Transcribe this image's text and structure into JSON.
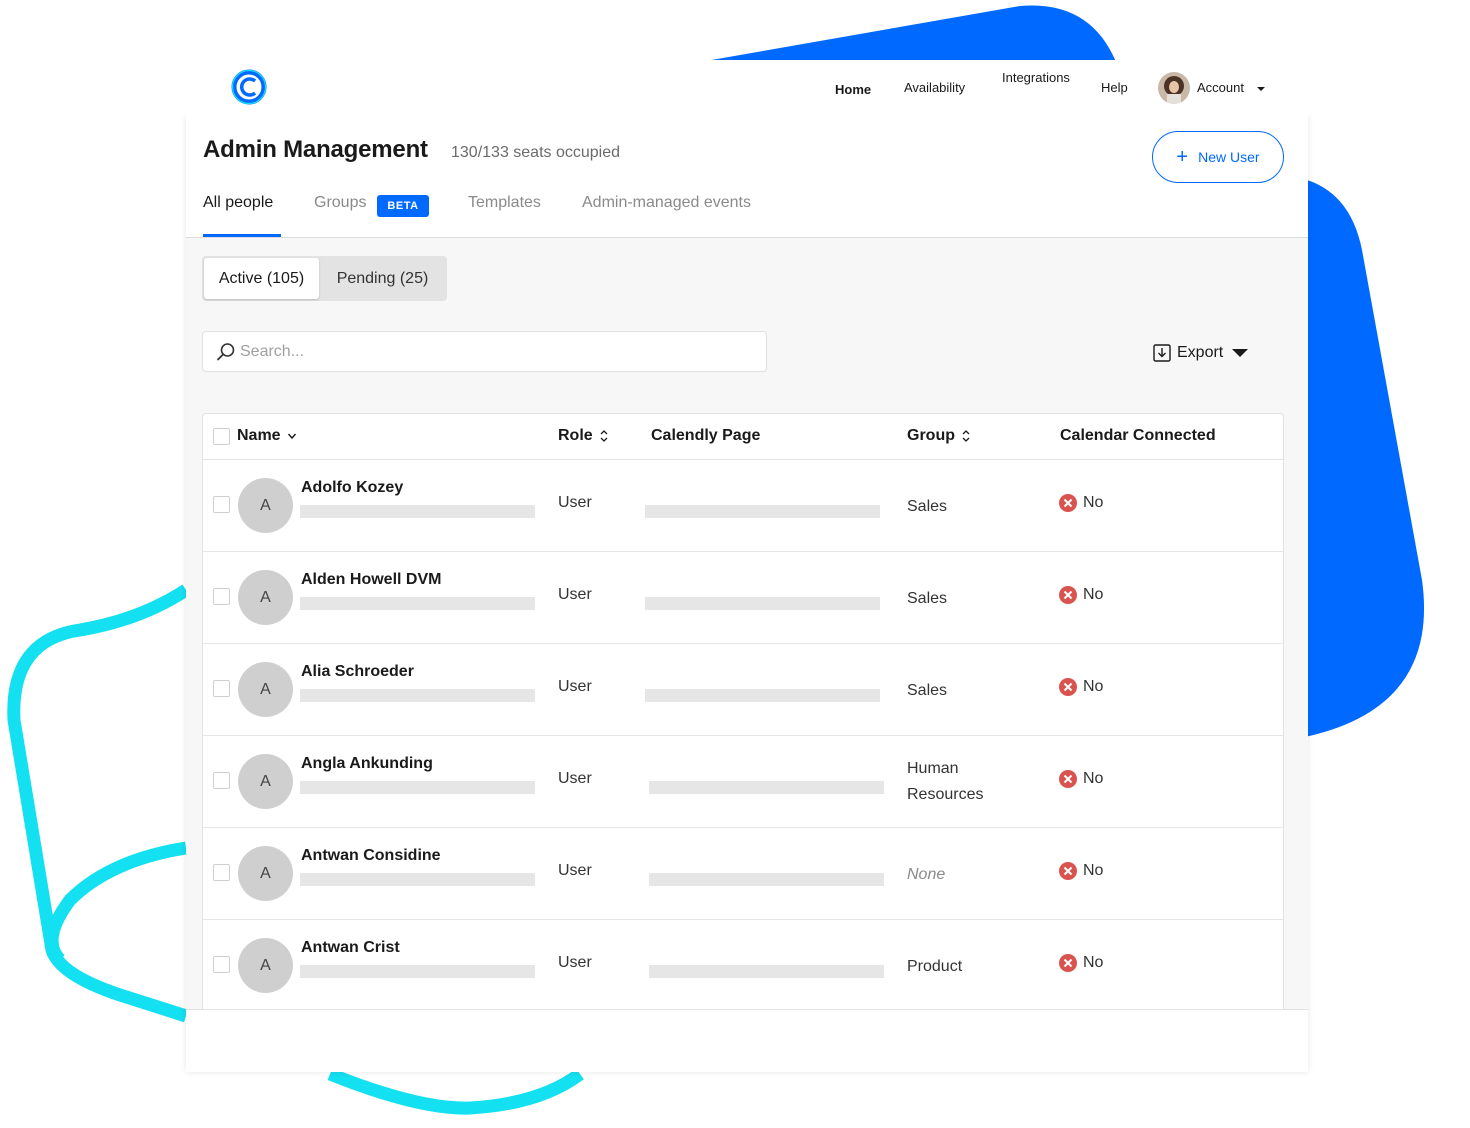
{
  "colors": {
    "accent": "#0069ff",
    "bg_blue": "#0069ff",
    "bg_cyan": "#13e0f0",
    "error_red": "#d9534f"
  },
  "nav": {
    "logo_icon": "calendly-logo-icon",
    "items": [
      "Home",
      "Availability",
      "Integrations",
      "Help"
    ],
    "account_label": "Account",
    "account_icon": "chevron-down-icon"
  },
  "header": {
    "title": "Admin Management",
    "seats": "130/133 seats occupied",
    "new_user_label": "New User",
    "new_user_icon": "plus-icon"
  },
  "tabs": [
    {
      "label": "All people",
      "active": true
    },
    {
      "label": "Groups",
      "badge": "BETA"
    },
    {
      "label": "Templates"
    },
    {
      "label": "Admin-managed events"
    }
  ],
  "segments": {
    "active": "Active (105)",
    "pending": "Pending (25)"
  },
  "search": {
    "placeholder": "Search...",
    "icon": "search-icon"
  },
  "export": {
    "label": "Export",
    "icon": "download-icon"
  },
  "table": {
    "columns": [
      "Name",
      "Role",
      "Calendly Page",
      "Group",
      "Calendar Connected"
    ],
    "rows": [
      {
        "initial": "A",
        "name": "Adolfo Kozey",
        "role": "User",
        "group": "Sales",
        "calendar": "No"
      },
      {
        "initial": "A",
        "name": "Alden Howell DVM",
        "role": "User",
        "group": "Sales",
        "calendar": "No"
      },
      {
        "initial": "A",
        "name": "Alia Schroeder",
        "role": "User",
        "group": "Sales",
        "calendar": "No"
      },
      {
        "initial": "A",
        "name": "Angla Ankunding",
        "role": "User",
        "group": "Human Resources",
        "calendar": "No"
      },
      {
        "initial": "A",
        "name": "Antwan Considine",
        "role": "User",
        "group": "None",
        "calendar": "No"
      },
      {
        "initial": "A",
        "name": "Antwan Crist",
        "role": "User",
        "group": "Product",
        "calendar": "No"
      }
    ]
  }
}
